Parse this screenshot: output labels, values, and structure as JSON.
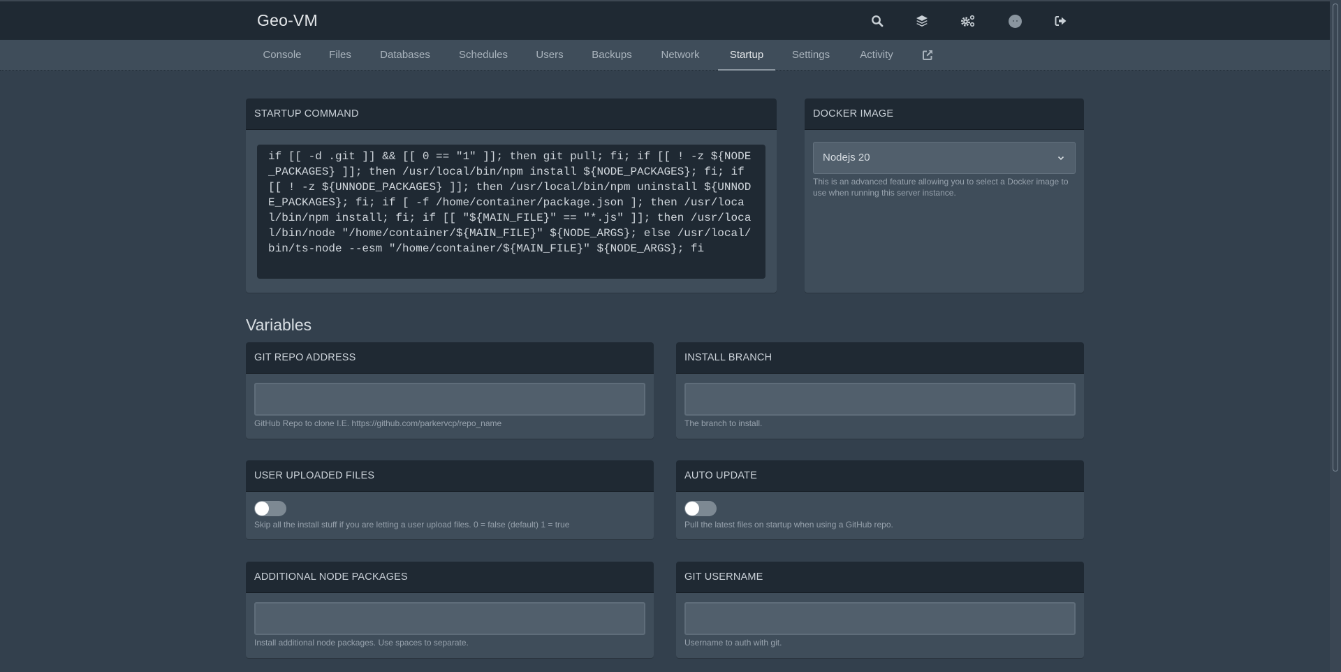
{
  "app": {
    "title": "Geo-VM"
  },
  "topbar": {
    "icons": [
      "search-icon",
      "layers-icon",
      "cogs-icon",
      "avatar-icon",
      "sign-out-icon"
    ]
  },
  "nav": {
    "tabs": [
      {
        "label": "Console",
        "active": false
      },
      {
        "label": "Files",
        "active": false
      },
      {
        "label": "Databases",
        "active": false
      },
      {
        "label": "Schedules",
        "active": false
      },
      {
        "label": "Users",
        "active": false
      },
      {
        "label": "Backups",
        "active": false
      },
      {
        "label": "Network",
        "active": false
      },
      {
        "label": "Startup",
        "active": true
      },
      {
        "label": "Settings",
        "active": false
      },
      {
        "label": "Activity",
        "active": false
      }
    ],
    "external_link_icon": "external-link-icon"
  },
  "startup": {
    "title": "STARTUP COMMAND",
    "command": "if [[ -d .git ]] && [[ 0 == \"1\" ]]; then git pull; fi; if [[ ! -z ${NODE_PACKAGES} ]]; then /usr/local/bin/npm install ${NODE_PACKAGES}; fi; if [[ ! -z ${UNNODE_PACKAGES} ]]; then /usr/local/bin/npm uninstall ${UNNODE_PACKAGES}; fi; if [ -f /home/container/package.json ]; then /usr/local/bin/npm install; fi; if [[ \"${MAIN_FILE}\" == \"*.js\" ]]; then /usr/local/bin/node \"/home/container/${MAIN_FILE}\" ${NODE_ARGS}; else /usr/local/bin/ts-node --esm \"/home/container/${MAIN_FILE}\" ${NODE_ARGS}; fi"
  },
  "docker": {
    "title": "DOCKER IMAGE",
    "selected": "Nodejs 20",
    "help": "This is an advanced feature allowing you to select a Docker image to use when running this server instance."
  },
  "variables": {
    "title": "Variables",
    "items": [
      {
        "name": "GIT REPO ADDRESS",
        "type": "text",
        "value": "",
        "help": "GitHub Repo to clone I.E. https://github.com/parkervcp/repo_name"
      },
      {
        "name": "INSTALL BRANCH",
        "type": "text",
        "value": "",
        "help": "The branch to install."
      },
      {
        "name": "USER UPLOADED FILES",
        "type": "toggle",
        "value": false,
        "help": "Skip all the install stuff if you are letting a user upload files. 0 = false (default) 1 = true"
      },
      {
        "name": "AUTO UPDATE",
        "type": "toggle",
        "value": false,
        "help": "Pull the latest files on startup when using a GitHub repo."
      },
      {
        "name": "ADDITIONAL NODE PACKAGES",
        "type": "text",
        "value": "",
        "help": "Install additional node packages. Use spaces to separate."
      },
      {
        "name": "GIT USERNAME",
        "type": "text",
        "value": "",
        "help": "Username to auth with git."
      }
    ]
  }
}
